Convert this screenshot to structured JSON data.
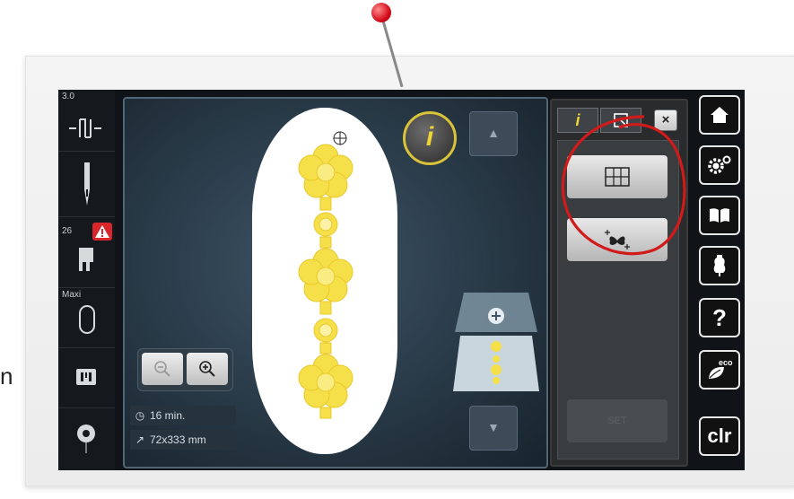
{
  "page": {
    "stray_letter": "n"
  },
  "left_toolbar": {
    "stitch_width_value": "3.0",
    "presser_foot_number": "26",
    "hoop_label": "Maxi",
    "icons": [
      "stitch-width-icon",
      "needle-icon",
      "presser-foot-icon",
      "hoop-icon",
      "stitch-plate-icon",
      "bobbin-icon"
    ]
  },
  "canvas": {
    "info_button_label": "i",
    "up_arrow": "▲",
    "down_arrow": "▼",
    "zoom_out_symbol": "−",
    "zoom_in_symbol": "+",
    "duration_text": "16 min.",
    "dimensions_text": "72x333 mm"
  },
  "right_panel": {
    "tab_info_label": "i",
    "close_label": "×",
    "set_label": "SET"
  },
  "right_toolbar": {
    "clr_label": "clr",
    "help_label": "?",
    "eco_label": "eco"
  },
  "colors": {
    "motif_yellow": "#f6e04a",
    "accent_yellow": "#f0d436",
    "annotation_red": "#d11a1a"
  }
}
